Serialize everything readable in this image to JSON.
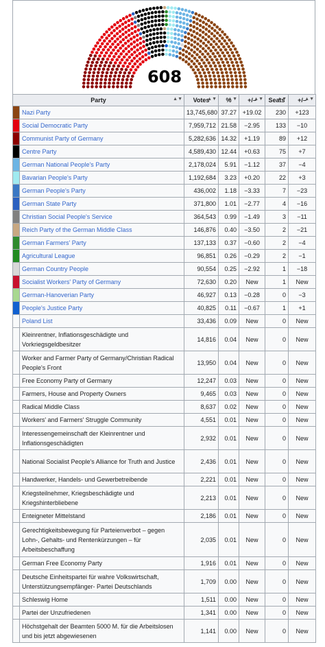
{
  "seat_total": "608",
  "headers": {
    "party": "Party",
    "votes": "Votes",
    "pct": "%",
    "chg": "+/–",
    "seats": "Seats",
    "seatchg": "+/–"
  },
  "parties": [
    {
      "name": "Nazi Party",
      "votes": "13,745,680",
      "pct": "37.27",
      "chg": "+19.02",
      "seats": "230",
      "seatchg": "+123",
      "color": "#8b4513",
      "link": true
    },
    {
      "name": "Social Democratic Party",
      "votes": "7,959,712",
      "pct": "21.58",
      "chg": "−2.95",
      "seats": "133",
      "seatchg": "−10",
      "color": "#e3000f",
      "link": true
    },
    {
      "name": "Communist Party of Germany",
      "votes": "5,282,636",
      "pct": "14.32",
      "chg": "+1.19",
      "seats": "89",
      "seatchg": "+12",
      "color": "#8b0000",
      "link": true
    },
    {
      "name": "Centre Party",
      "votes": "4,589,430",
      "pct": "12.44",
      "chg": "+0.63",
      "seats": "75",
      "seatchg": "+7",
      "color": "#000000",
      "link": true
    },
    {
      "name": "German National People's Party",
      "votes": "2,178,024",
      "pct": "5.91",
      "chg": "−1.12",
      "seats": "37",
      "seatchg": "−4",
      "color": "#6cb4e4",
      "link": true
    },
    {
      "name": "Bavarian People's Party",
      "votes": "1,192,684",
      "pct": "3.23",
      "chg": "+0.20",
      "seats": "22",
      "seatchg": "+3",
      "color": "#a0eaf0",
      "link": true
    },
    {
      "name": "German People's Party",
      "votes": "436,002",
      "pct": "1.18",
      "chg": "−3.33",
      "seats": "7",
      "seatchg": "−23",
      "color": "#3a78c4",
      "link": true
    },
    {
      "name": "German State Party",
      "votes": "371,800",
      "pct": "1.01",
      "chg": "−2.77",
      "seats": "4",
      "seatchg": "−16",
      "color": "#2a60c0",
      "link": true
    },
    {
      "name": "Christian Social People's Service",
      "votes": "364,543",
      "pct": "0.99",
      "chg": "−1.49",
      "seats": "3",
      "seatchg": "−11",
      "color": "#808080",
      "link": true
    },
    {
      "name": "Reich Party of the German Middle Class",
      "votes": "146,876",
      "pct": "0.40",
      "chg": "−3.50",
      "seats": "2",
      "seatchg": "−21",
      "color": "#c8a882",
      "link": true
    },
    {
      "name": "German Farmers' Party",
      "votes": "137,133",
      "pct": "0.37",
      "chg": "−0.60",
      "seats": "2",
      "seatchg": "−4",
      "color": "#2e8b2e",
      "link": true
    },
    {
      "name": "Agricultural League",
      "votes": "96,851",
      "pct": "0.26",
      "chg": "−0.29",
      "seats": "2",
      "seatchg": "−1",
      "color": "#228b22",
      "link": true
    },
    {
      "name": "German Country People",
      "votes": "90,554",
      "pct": "0.25",
      "chg": "−2.92",
      "seats": "1",
      "seatchg": "−18",
      "color": "#d8d8d8",
      "link": true
    },
    {
      "name": "Socialist Workers' Party of Germany",
      "votes": "72,630",
      "pct": "0.20",
      "chg": "New",
      "seats": "1",
      "seatchg": "New",
      "color": "#c8102e",
      "link": true
    },
    {
      "name": "German-Hanoverian Party",
      "votes": "46,927",
      "pct": "0.13",
      "chg": "−0.28",
      "seats": "0",
      "seatchg": "−3",
      "color": "#a8d890",
      "link": true
    },
    {
      "name": "People's Justice Party",
      "votes": "40,825",
      "pct": "0.11",
      "chg": "−0.67",
      "seats": "1",
      "seatchg": "+1",
      "color": "#1060d0",
      "link": true
    },
    {
      "name": "Poland List",
      "votes": "33,436",
      "pct": "0.09",
      "chg": "New",
      "seats": "0",
      "seatchg": "New",
      "color": "",
      "link": true
    },
    {
      "name": "Kleinrentner, Inflationsgeschädigte und Vorkriegsgeldbesitzer",
      "votes": "14,816",
      "pct": "0.04",
      "chg": "New",
      "seats": "0",
      "seatchg": "New",
      "color": "",
      "link": false
    },
    {
      "name": "Worker and Farmer Party of Germany/Christian Radical People's Front",
      "votes": "13,950",
      "pct": "0.04",
      "chg": "New",
      "seats": "0",
      "seatchg": "New",
      "color": "",
      "link": false
    },
    {
      "name": "Free Economy Party of Germany",
      "votes": "12,247",
      "pct": "0.03",
      "chg": "New",
      "seats": "0",
      "seatchg": "New",
      "color": "",
      "link": false
    },
    {
      "name": "Farmers, House and Property Owners",
      "votes": "9,465",
      "pct": "0.03",
      "chg": "New",
      "seats": "0",
      "seatchg": "New",
      "color": "",
      "link": false
    },
    {
      "name": "Radical Middle Class",
      "votes": "8,637",
      "pct": "0.02",
      "chg": "New",
      "seats": "0",
      "seatchg": "New",
      "color": "",
      "link": false
    },
    {
      "name": "Workers' and Farmers' Struggle Community",
      "votes": "4,551",
      "pct": "0.01",
      "chg": "New",
      "seats": "0",
      "seatchg": "New",
      "color": "",
      "link": false
    },
    {
      "name": "Interessengemeinschaft der Kleinrentner und Inflationsgeschädigten",
      "votes": "2,932",
      "pct": "0.01",
      "chg": "New",
      "seats": "0",
      "seatchg": "New",
      "color": "",
      "link": false
    },
    {
      "name": "National Socialist People's Alliance for Truth and Justice",
      "votes": "2,436",
      "pct": "0.01",
      "chg": "New",
      "seats": "0",
      "seatchg": "New",
      "color": "",
      "link": false
    },
    {
      "name": "Handwerker, Handels- und Gewerbetreibende",
      "votes": "2,221",
      "pct": "0.01",
      "chg": "New",
      "seats": "0",
      "seatchg": "New",
      "color": "",
      "link": false
    },
    {
      "name": "Kriegsteilnehmer, Kriegsbeschädigte und Kriegshinterbliebene",
      "votes": "2,213",
      "pct": "0.01",
      "chg": "New",
      "seats": "0",
      "seatchg": "New",
      "color": "",
      "link": false
    },
    {
      "name": "Enteigneter Mittelstand",
      "votes": "2,186",
      "pct": "0.01",
      "chg": "New",
      "seats": "0",
      "seatchg": "New",
      "color": "",
      "link": false
    },
    {
      "name": "Gerechtigkeitsbewegung für Parteienverbot – gegen Lohn-, Gehalts- und Rentenkürzungen – für Arbeitsbeschaffung",
      "votes": "2,035",
      "pct": "0.01",
      "chg": "New",
      "seats": "0",
      "seatchg": "New",
      "color": "",
      "link": false
    },
    {
      "name": "German Free Economy Party",
      "votes": "1,916",
      "pct": "0.01",
      "chg": "New",
      "seats": "0",
      "seatchg": "New",
      "color": "",
      "link": false
    },
    {
      "name": "Deutsche Einheitspartei für wahre Volkswirtschaft, Unterstützungsempfänger- Partei Deutschlands",
      "votes": "1,709",
      "pct": "0.00",
      "chg": "New",
      "seats": "0",
      "seatchg": "New",
      "color": "",
      "link": false
    },
    {
      "name": "Schleswig Home",
      "votes": "1,511",
      "pct": "0.00",
      "chg": "New",
      "seats": "0",
      "seatchg": "New",
      "color": "",
      "link": false
    },
    {
      "name": "Partei der Unzufriedenen",
      "votes": "1,341",
      "pct": "0.00",
      "chg": "New",
      "seats": "0",
      "seatchg": "New",
      "color": "",
      "link": false
    },
    {
      "name": "Höchstgehalt der Beamten 5000 M. für die Arbeitslosen und bis jetzt abgewiesenen",
      "votes": "1,141",
      "pct": "0.00",
      "chg": "New",
      "seats": "0",
      "seatchg": "New",
      "color": "",
      "link": false
    }
  ]
}
